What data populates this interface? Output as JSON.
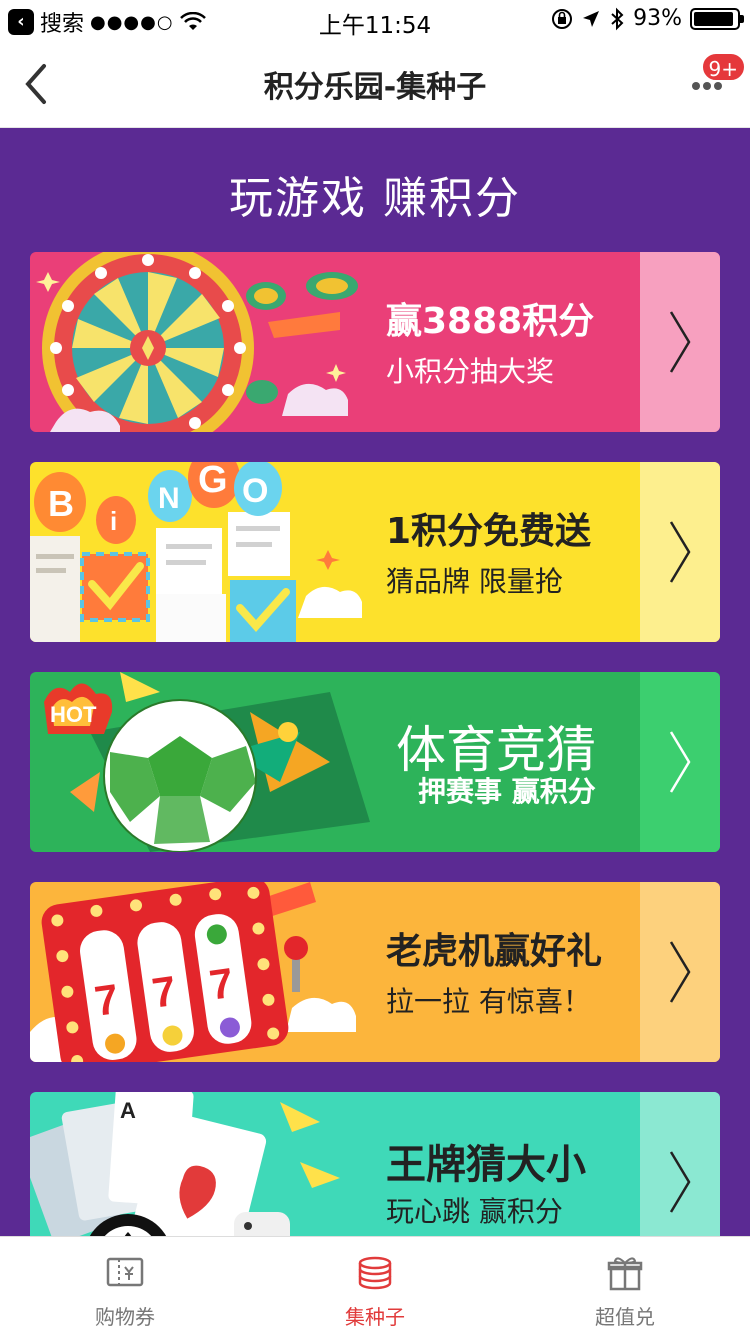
{
  "status_bar": {
    "carrier": "搜索",
    "signal": "●●●●○",
    "time": "上午11:54",
    "battery_percent": "93%",
    "battery_level": 0.93
  },
  "nav": {
    "title": "积分乐园-集种子",
    "badge": "9+"
  },
  "headline": "玩游戏 赚积分",
  "cards": [
    {
      "title": "赢3888积分",
      "subtitle": "小积分抽大奖"
    },
    {
      "title": "1积分免费送",
      "subtitle": "猜品牌  限量抢",
      "art_letters": [
        "B",
        "i",
        "N",
        "G",
        "O"
      ]
    },
    {
      "title": "体育竞猜",
      "subtitle": "押赛事 赢积分",
      "art_label": "HOT"
    },
    {
      "title": "老虎机赢好礼",
      "subtitle": "拉一拉 有惊喜！",
      "art_digits": [
        "7",
        "7",
        "7"
      ]
    },
    {
      "title": "王牌猜大小",
      "subtitle": "玩心跳 赢积分",
      "art_card": "A"
    }
  ],
  "tabs": [
    {
      "label": "购物券",
      "icon": "coupon-icon",
      "active": false
    },
    {
      "label": "集种子",
      "icon": "coin-stack-icon",
      "active": true
    },
    {
      "label": "超值兑",
      "icon": "gift-icon",
      "active": false
    }
  ],
  "colors": {
    "background": "#5b2a93",
    "card_pink": "#ea3f78",
    "card_yellow": "#fde12c",
    "card_green": "#2db35a",
    "card_orange": "#fcb53c",
    "card_teal": "#3fd9b8",
    "accent_red": "#e13b3b"
  }
}
